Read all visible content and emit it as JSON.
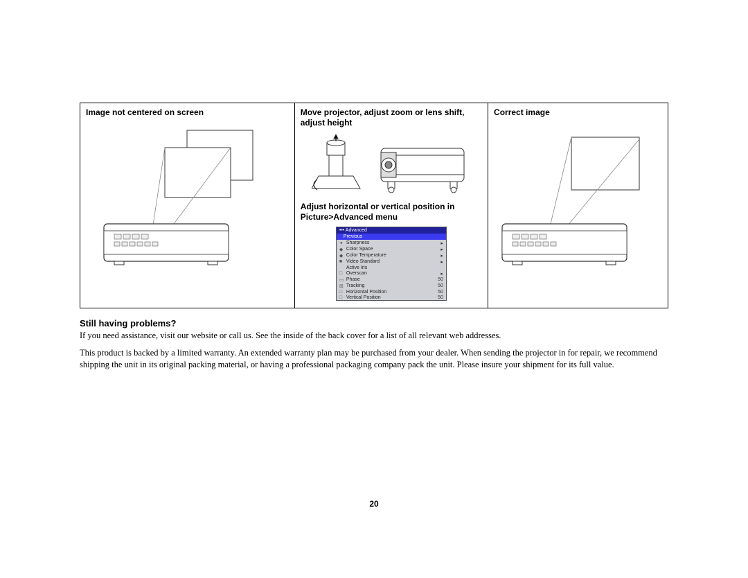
{
  "table": {
    "col1_title": "Image not centered on screen",
    "col2_title": "Move projector, adjust zoom or lens shift, adjust height",
    "col2_subtitle": "Adjust horizontal or vertical position in Picture>Advanced menu",
    "col3_title": "Correct image"
  },
  "menu": {
    "header": "••• Advanced",
    "previous": "Previous",
    "rows": [
      {
        "label": "Sharpness",
        "arrow": "▸"
      },
      {
        "label": "Color Space",
        "arrow": "▸"
      },
      {
        "label": "Color Temperature",
        "arrow": "▸"
      },
      {
        "label": "Video Standard",
        "arrow": "▸"
      },
      {
        "label": "Active Iris",
        "arrow": ""
      },
      {
        "label": "Overscan",
        "arrow": "▸"
      },
      {
        "label": "Phase",
        "value": "50"
      },
      {
        "label": "Tracking",
        "value": "50"
      },
      {
        "label": "Horizontal Position",
        "value": "50"
      },
      {
        "label": "Vertical Position",
        "value": "50"
      }
    ]
  },
  "body": {
    "heading": "Still having problems?",
    "para1": "If you need assistance, visit our website or call us. See the inside of the back cover for a list of all relevant web addresses.",
    "para2": "This product is backed by a limited warranty. An extended warranty plan may be purchased from your dealer. When sending the projector in for repair, we recommend shipping the unit in its original packing material, or having a professional packaging company pack the unit. Please insure your shipment for its full value."
  },
  "page_number": "20"
}
